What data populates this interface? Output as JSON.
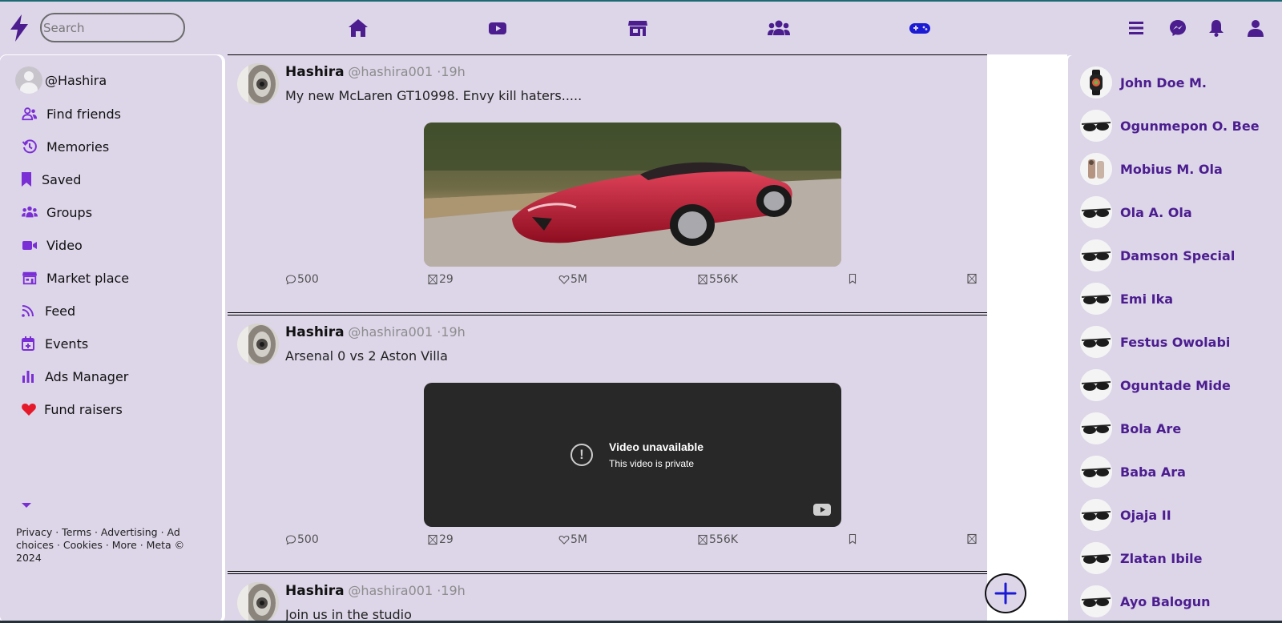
{
  "search": {
    "placeholder": "Search"
  },
  "nav_icons": [
    "home-icon",
    "video-icon",
    "store-icon",
    "groups-icon",
    "gaming-icon",
    "menu-icon",
    "messenger-icon",
    "bell-icon",
    "user-icon"
  ],
  "colors": {
    "accent": "#4b1d8f",
    "active_nav": "#1b1bd6",
    "bg": "#ddd5e8",
    "heart": "#e5192a"
  },
  "profile": {
    "handle": "@Hashira"
  },
  "sidebar": {
    "items": [
      {
        "label": "Find friends",
        "icon": "friends-icon"
      },
      {
        "label": "Memories",
        "icon": "history-icon"
      },
      {
        "label": "Saved",
        "icon": "bookmark-icon"
      },
      {
        "label": "Groups",
        "icon": "groups-icon"
      },
      {
        "label": "Video",
        "icon": "video-camera-icon"
      },
      {
        "label": "Market place",
        "icon": "store-icon"
      },
      {
        "label": "Feed",
        "icon": "rss-icon"
      },
      {
        "label": "Events",
        "icon": "calendar-icon"
      },
      {
        "label": "Ads Manager",
        "icon": "bar-chart-icon"
      },
      {
        "label": "Fund raisers",
        "icon": "heart-icon"
      }
    ],
    "legal": "Privacy · Terms · Advertising · Ad choices · Cookies · More · Meta © 2024"
  },
  "posts": [
    {
      "name": "Hashira",
      "handle": "@hashira001 ·19h",
      "text": "My new McLaren GT10998. Envy kill haters.....",
      "media": "image",
      "stats": {
        "comments": "500",
        "reposts": "29",
        "likes": "5M",
        "views": "556K"
      }
    },
    {
      "name": "Hashira",
      "handle": "@hashira001 ·19h",
      "text": "Arsenal 0 vs 2 Aston Villa",
      "media": "video",
      "video_title": "Video unavailable",
      "video_sub": "This video is private",
      "stats": {
        "comments": "500",
        "reposts": "29",
        "likes": "5M",
        "views": "556K"
      }
    },
    {
      "name": "Hashira",
      "handle": "@hashira001 ·19h",
      "text": "Join us in the studio"
    }
  ],
  "contacts": [
    "John Doe M.",
    "Ogunmepon O. Bee",
    "Mobius M. Ola",
    "Ola A. Ola",
    "Damson Special",
    "Emi Ika",
    "Festus Owolabi",
    "Oguntade Mide",
    "Bola Are",
    "Baba Ara",
    "Ojaja II",
    "Zlatan Ibile",
    "Ayo Balogun"
  ]
}
